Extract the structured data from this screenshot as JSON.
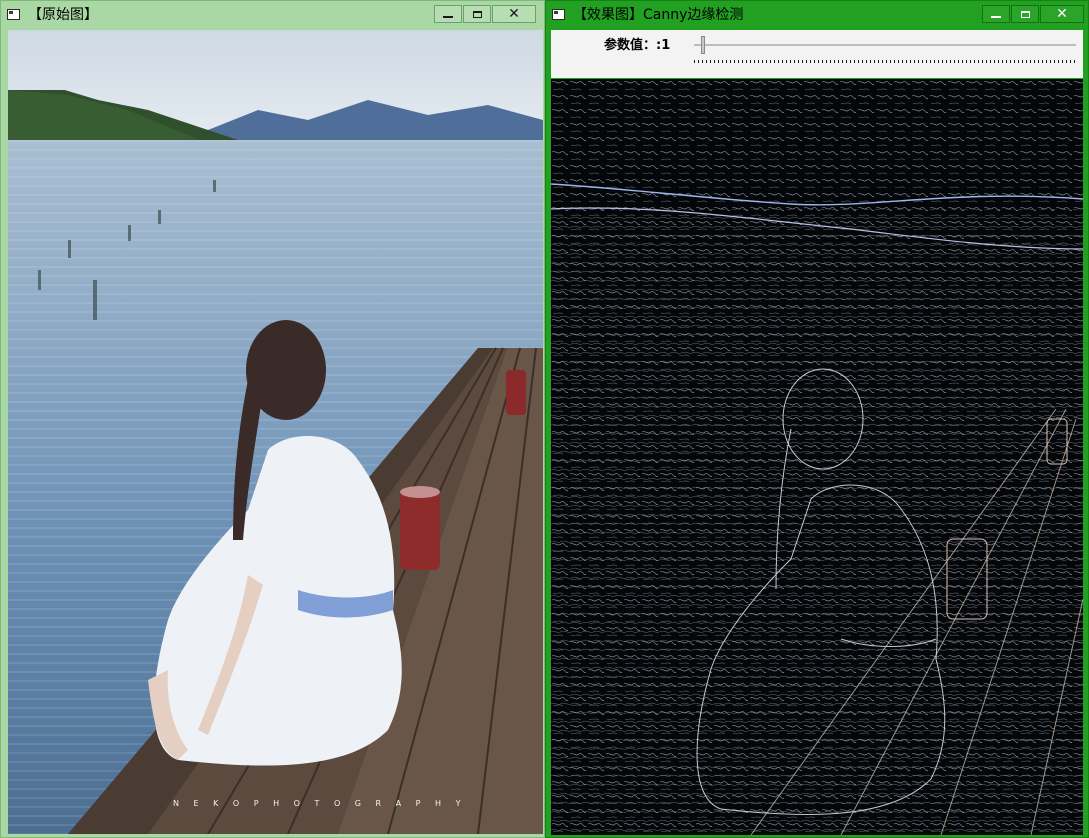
{
  "windows": {
    "original": {
      "title": "【原始图】"
    },
    "result": {
      "title": "【效果图】Canny边缘检测",
      "trackbar": {
        "label": "参数值：",
        "value": ":1"
      }
    }
  },
  "photo": {
    "watermark": "N E K O P H O T O G R A P H Y"
  },
  "controls": {
    "minimize": "minimize",
    "maximize": "maximize",
    "close": "close"
  }
}
